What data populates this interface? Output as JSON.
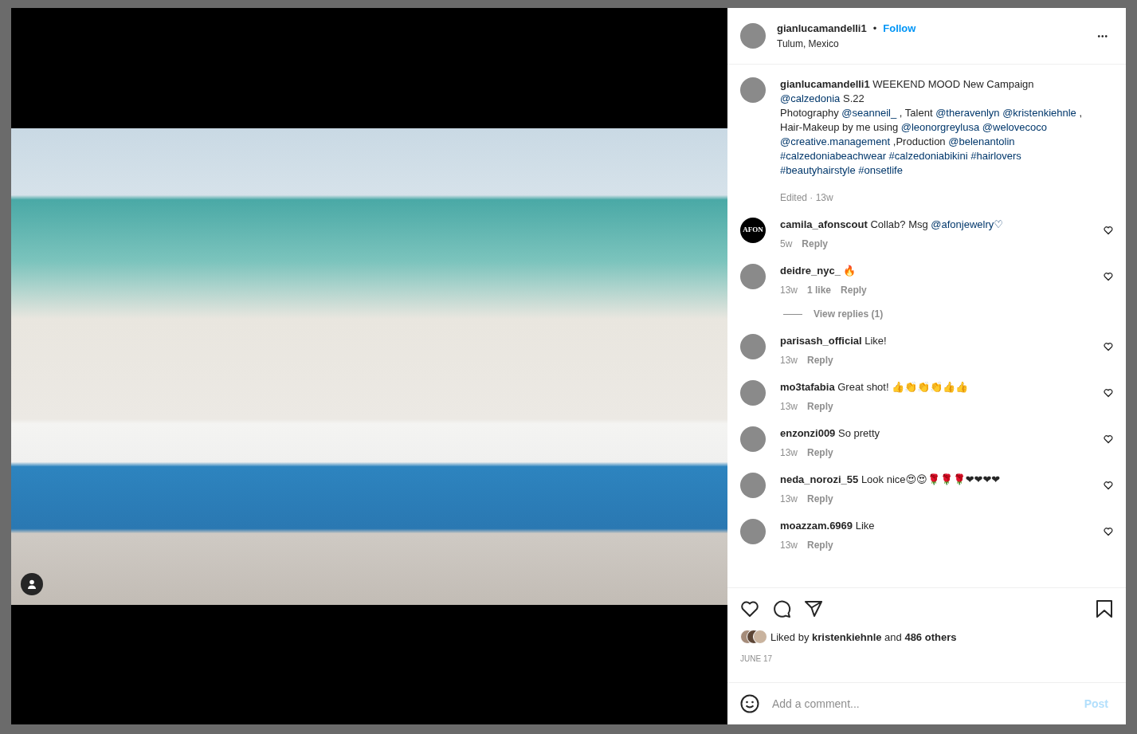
{
  "post": {
    "author": "gianlucamandelli1",
    "separator": "•",
    "follow": "Follow",
    "location": "Tulum, Mexico",
    "more": "•••"
  },
  "caption": {
    "author": "gianlucamandelli1",
    "segments": [
      {
        "kind": "text",
        "text": "WEEKEND MOOD New Campaign"
      },
      {
        "kind": "break"
      },
      {
        "kind": "mention",
        "text": "@calzedonia"
      },
      {
        "kind": "text",
        "text": "S.22"
      },
      {
        "kind": "break"
      },
      {
        "kind": "text",
        "text": "Photography"
      },
      {
        "kind": "mention",
        "text": "@seanneil_"
      },
      {
        "kind": "text",
        "text": ", Talent"
      },
      {
        "kind": "mention",
        "text": "@theravenlyn"
      },
      {
        "kind": "mention",
        "text": "@kristenkiehnle"
      },
      {
        "kind": "text",
        "text": ","
      },
      {
        "kind": "break"
      },
      {
        "kind": "text",
        "text": "Hair-Makeup by me using"
      },
      {
        "kind": "mention",
        "text": "@leonorgreylusa"
      },
      {
        "kind": "mention",
        "text": "@welovecoco"
      },
      {
        "kind": "break"
      },
      {
        "kind": "mention",
        "text": "@creative.management"
      },
      {
        "kind": "text",
        "text": ",Production"
      },
      {
        "kind": "mention",
        "text": "@belenantolin"
      },
      {
        "kind": "break"
      },
      {
        "kind": "mention",
        "text": "#calzedoniabeachwear"
      },
      {
        "kind": "mention",
        "text": "#calzedoniabikini"
      },
      {
        "kind": "mention",
        "text": "#hairlovers"
      },
      {
        "kind": "break"
      },
      {
        "kind": "mention",
        "text": "#beautyhairstyle"
      },
      {
        "kind": "mention",
        "text": "#onsetlife"
      }
    ],
    "meta": "Edited · 13w"
  },
  "comments": [
    {
      "user": "camila_afonscout",
      "avatar_text": "AFON",
      "segments": [
        {
          "kind": "text",
          "text": "Collab? Msg"
        },
        {
          "kind": "mention",
          "text": "@afonjewelry♡"
        }
      ],
      "time": "5w",
      "reply": "Reply"
    },
    {
      "user": "deidre_nyc_",
      "segments": [
        {
          "kind": "text",
          "text": "🔥"
        }
      ],
      "time": "13w",
      "likes": "1 like",
      "reply": "Reply",
      "view_replies": "View replies (1)"
    },
    {
      "user": "parisash_official",
      "segments": [
        {
          "kind": "text",
          "text": "Like!"
        }
      ],
      "time": "13w",
      "reply": "Reply"
    },
    {
      "user": "mo3tafabia",
      "segments": [
        {
          "kind": "text",
          "text": "Great shot! 👍👏👏👏👍👍"
        }
      ],
      "time": "13w",
      "reply": "Reply"
    },
    {
      "user": "enzonzi009",
      "segments": [
        {
          "kind": "text",
          "text": "So pretty"
        }
      ],
      "time": "13w",
      "reply": "Reply"
    },
    {
      "user": "neda_norozi_55",
      "segments": [
        {
          "kind": "text",
          "text": "Look nice😍😍🌹🌹🌹❤❤❤❤"
        }
      ],
      "time": "13w",
      "reply": "Reply"
    },
    {
      "user": "moazzam.6969",
      "segments": [
        {
          "kind": "text",
          "text": "Like"
        }
      ],
      "time": "13w",
      "reply": "Reply"
    }
  ],
  "likes": {
    "text": "Liked by **kristenkiehnle** and **486 others**",
    "date": "JUNE 17"
  },
  "add_comment": {
    "placeholder": "Add a comment...",
    "post": "Post"
  }
}
